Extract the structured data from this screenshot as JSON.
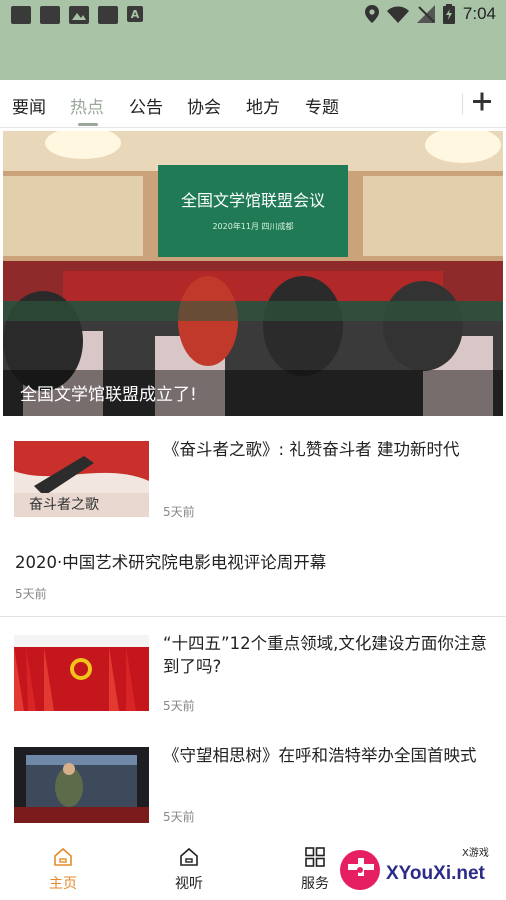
{
  "status_bar": {
    "time": "7:04"
  },
  "tabs": [
    "要闻",
    "热点",
    "公告",
    "协会",
    "地方",
    "专题"
  ],
  "hero": {
    "caption": "全国文学馆联盟成立了!",
    "banner_text": "全国文学馆联盟会议",
    "banner_sub": "2020年11月 四川成都"
  },
  "news": [
    {
      "title": "《奋斗者之歌》: 礼赞奋斗者 建功新时代",
      "time": "5天前",
      "thumb_text": "奋斗者之歌"
    },
    {
      "title": "2020·中国艺术研究院电影电视评论周开幕",
      "time": "5天前"
    },
    {
      "title": "“十四五”12个重点领域,文化建设方面你注意到了吗?",
      "time": "5天前"
    },
    {
      "title": "《守望相思树》在呼和浩特举办全国首映式",
      "time": "5天前"
    }
  ],
  "bottom_nav": [
    {
      "label": "主页",
      "icon": "home-icon",
      "active": true
    },
    {
      "label": "视听",
      "icon": "media-home-icon",
      "active": false
    },
    {
      "label": "服务",
      "icon": "grid-icon",
      "active": false
    }
  ],
  "watermark": {
    "site": "XYouXi.net",
    "tag": "X游戏"
  },
  "colors": {
    "header_green": "#a8c3a6",
    "active_tab": "#9aa79a",
    "active_nav": "#e58b2a"
  }
}
